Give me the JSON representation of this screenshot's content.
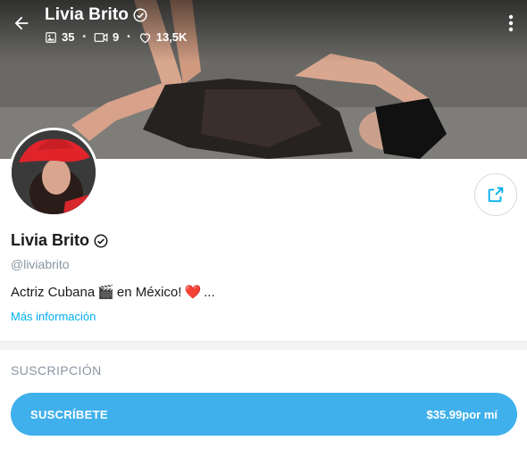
{
  "header": {
    "title": "Livia Brito",
    "stats": {
      "photos": "35",
      "videos": "9",
      "likes": "13,5K"
    },
    "separator": "•"
  },
  "profile": {
    "name": "Livia Brito",
    "handle": "@liviabrito",
    "bio_text_1": "Actriz Cubana",
    "bio_emoji_1": "🎬",
    "bio_text_2": "en México!",
    "bio_emoji_2": "❤️",
    "bio_ellipsis": "...",
    "more_info": "Más información"
  },
  "subscription": {
    "heading": "SUSCRIPCIÓN",
    "button_label": "SUSCRÍBETE",
    "price": "$35.99por mí"
  },
  "colors": {
    "accent": "#00aff0",
    "button": "#3fb0ec",
    "muted": "#8a96a3"
  },
  "icons": [
    "back-arrow-icon",
    "verified-icon",
    "image-icon",
    "video-icon",
    "heart-icon",
    "more-vertical-icon",
    "share-icon"
  ]
}
